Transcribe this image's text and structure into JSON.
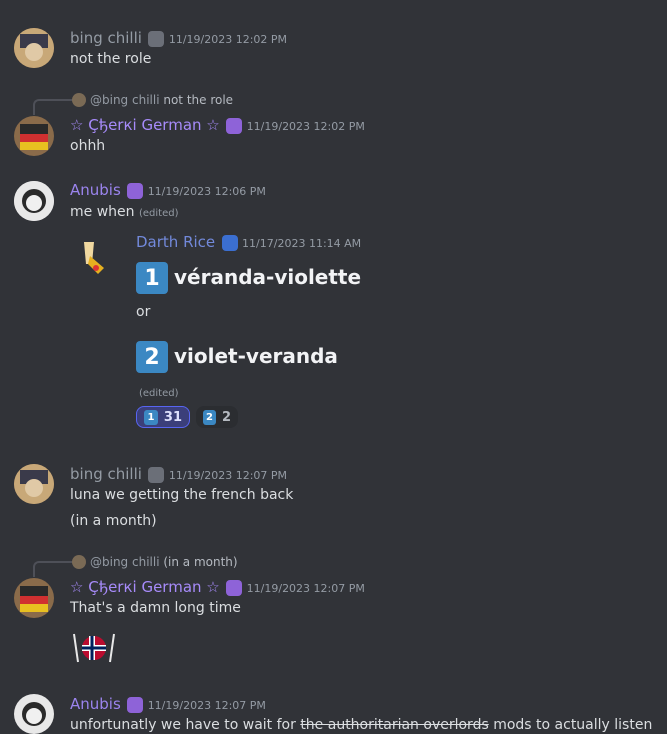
{
  "colors": {
    "bing": "#949ba4",
    "cherki": "#a78bfa",
    "anubis": "#9b84ee",
    "darth": "#7289da",
    "background": "#313338"
  },
  "messages": [
    {
      "author": "bing chilli",
      "time": "11/19/2023 12:02 PM",
      "lines": [
        "not the role"
      ]
    },
    {
      "reply": {
        "author": "@bing chilli",
        "text": "not the role"
      },
      "author": "☆ Çђerкi German ☆",
      "time": "11/19/2023 12:02 PM",
      "lines": [
        "ohhh"
      ]
    },
    {
      "author": "Anubis",
      "time": "11/19/2023 12:06 PM",
      "lines": [
        "me when"
      ],
      "edited": "(edited)",
      "forward": {
        "author": "Darth Rice",
        "time": "11/17/2023 11:14 AM",
        "options": [
          {
            "num": "1",
            "text": "véranda-violette"
          },
          {
            "num": "2",
            "text": "violet-veranda"
          }
        ],
        "or_text": "or",
        "edited": "(edited)",
        "reactions": [
          {
            "num": "1",
            "count": "31"
          },
          {
            "num": "2",
            "count": "2"
          }
        ]
      }
    },
    {
      "author": "bing chilli",
      "time": "11/19/2023 12:07 PM",
      "lines": [
        "luna we getting the french back",
        "(in a month)"
      ]
    },
    {
      "reply": {
        "author": "@bing chilli",
        "text": "(in a month)"
      },
      "author": "☆ Çђerкi German ☆",
      "time": "11/19/2023 12:07 PM",
      "lines": [
        "That's a damn long time"
      ]
    },
    {
      "author": "Anubis",
      "time": "11/19/2023 12:07 PM",
      "lines": [
        "unfortunatly we have to wait for"
      ],
      "strikethrough": "the authoritarian overlords",
      "after": "mods to actually listen"
    }
  ]
}
